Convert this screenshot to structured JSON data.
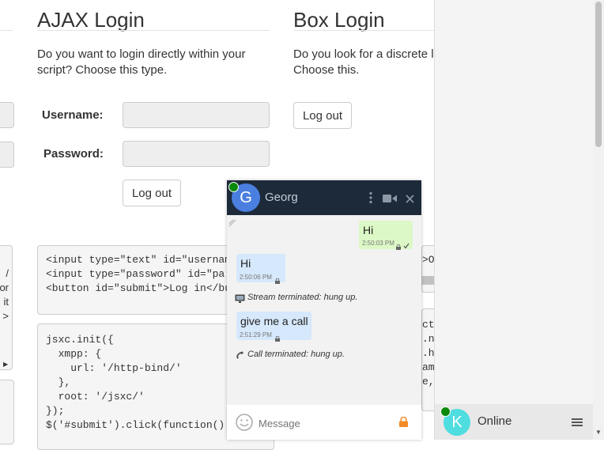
{
  "ajax": {
    "title": "AJAX Login",
    "description_line1": "Do you want to login directly within your",
    "description_line2": "script? Choose this type.",
    "username_label": "Username:",
    "password_label": "Password:",
    "logout_label": "Log out",
    "code1": [
      "<input type=\"text\" id=\"usernam",
      "<input type=\"password\" id=\"pa",
      "<button id=\"submit\">Log in</bu"
    ],
    "code2": [
      "jsxc.init({",
      "  xmpp: {",
      "    url: '/http-bind/'",
      "  },",
      "  root: '/jsxc/'",
      "});",
      "",
      "$('#submit').click(function()"
    ]
  },
  "box": {
    "title": "Box Login",
    "description_line1": "Do you look for a discrete log",
    "description_line2": "Choose this.",
    "logout_label": "Log out",
    "code_frag1": [
      ">Op"
    ],
    "code_frag2": [
      "cti",
      "",
      ".no",
      ".ho",
      "amp",
      "e,",
      "}"
    ]
  },
  "left_frag": {
    "code1": [
      "/",
      "or",
      "it",
      "",
      ">"
    ],
    "arrow": "▶"
  },
  "chat": {
    "contact_name": "Georg",
    "contact_initial": "G",
    "messages": [
      {
        "text": "Hi",
        "time": "2:50:03 PM",
        "direction": "out"
      },
      {
        "text": "Hi",
        "time": "2:50:06 PM",
        "direction": "in"
      },
      {
        "text": "give me a call",
        "time": "2:51:29 PM",
        "direction": "in"
      }
    ],
    "system1": "Stream terminated: hung up.",
    "system2": "Call terminated: hung up.",
    "message_placeholder": "Message"
  },
  "roster": {
    "initial": "K",
    "status": "Online"
  },
  "colors": {
    "chat_header": "#1d2a3a",
    "avatar_g": "#4a7fe0",
    "avatar_k": "#4fdde0",
    "presence": "#0a8a0a",
    "outgoing": "#dcf8c6",
    "incoming": "#d6e8fb",
    "lock": "#f28c28"
  }
}
